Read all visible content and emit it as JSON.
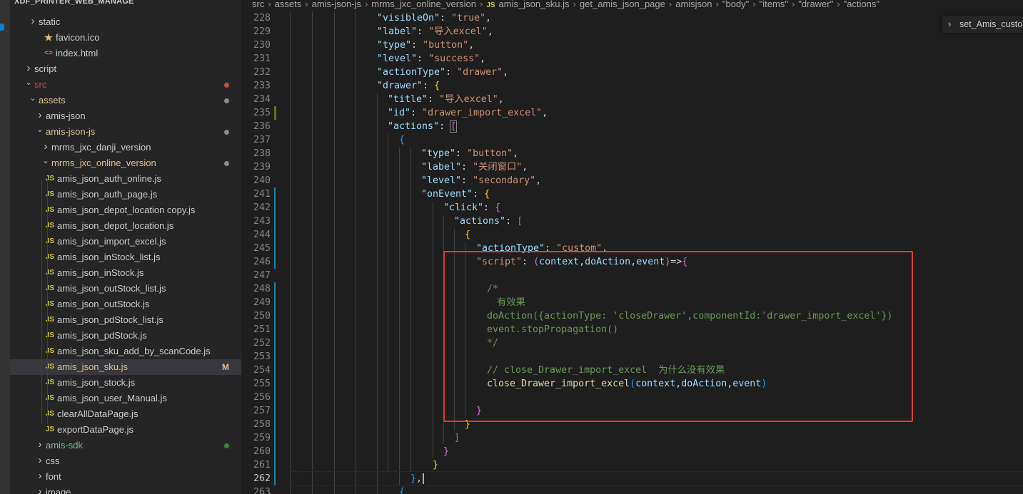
{
  "explorer": {
    "root": "XDF_PRINTER_WEB_MANAGE",
    "items": [
      {
        "label": "static",
        "type": "folder-closed",
        "depth": 1,
        "icon": "chevron-right"
      },
      {
        "label": "favicon.ico",
        "type": "file",
        "depth": 1,
        "icon": "star-icon"
      },
      {
        "label": "index.html",
        "type": "file",
        "depth": 1,
        "icon": "html-icon"
      },
      {
        "label": "script",
        "type": "folder-closed",
        "depth": 0,
        "icon": "chevron-right"
      },
      {
        "label": "src",
        "type": "folder-open",
        "depth": 0,
        "icon": "chevron-down",
        "status": "error-dot"
      },
      {
        "label": "assets",
        "type": "folder-open",
        "depth": 1,
        "icon": "chevron-down",
        "status": "modified-dot"
      },
      {
        "label": "amis-json",
        "type": "folder-closed",
        "depth": 2,
        "icon": "chevron-right"
      },
      {
        "label": "amis-json-js",
        "type": "folder-open",
        "depth": 2,
        "icon": "chevron-down",
        "status": "modified-dot"
      },
      {
        "label": "mrms_jxc_danji_version",
        "type": "folder-closed",
        "depth": 3,
        "icon": "chevron-right"
      },
      {
        "label": "mrms_jxc_online_version",
        "type": "folder-open",
        "depth": 3,
        "icon": "chevron-down",
        "status": "modified-dot"
      },
      {
        "label": "amis_json_auth_online.js",
        "type": "js",
        "depth": 4
      },
      {
        "label": "amis_json_auth_page.js",
        "type": "js",
        "depth": 4
      },
      {
        "label": "amis_json_depot_location copy.js",
        "type": "js",
        "depth": 4
      },
      {
        "label": "amis_json_depot_location.js",
        "type": "js",
        "depth": 4
      },
      {
        "label": "amis_json_import_excel.js",
        "type": "js",
        "depth": 4
      },
      {
        "label": "amis_json_inStock_list.js",
        "type": "js",
        "depth": 4
      },
      {
        "label": "amis_json_inStock.js",
        "type": "js",
        "depth": 4
      },
      {
        "label": "amis_json_outStock_list.js",
        "type": "js",
        "depth": 4
      },
      {
        "label": "amis_json_outStock.js",
        "type": "js",
        "depth": 4
      },
      {
        "label": "amis_json_pdStock_list.js",
        "type": "js",
        "depth": 4
      },
      {
        "label": "amis_json_pdStock.js",
        "type": "js",
        "depth": 4
      },
      {
        "label": "amis_json_sku_add_by_scanCode.js",
        "type": "js",
        "depth": 4
      },
      {
        "label": "amis_json_sku.js",
        "type": "js",
        "depth": 4,
        "selected": true,
        "badge": "M"
      },
      {
        "label": "amis_json_stock.js",
        "type": "js",
        "depth": 4
      },
      {
        "label": "amis_json_user_Manual.js",
        "type": "js",
        "depth": 4
      },
      {
        "label": "clearAllDataPage.js",
        "type": "js",
        "depth": 4
      },
      {
        "label": "exportDataPage.js",
        "type": "js",
        "depth": 4
      },
      {
        "label": "amis-sdk",
        "type": "folder-closed",
        "depth": 2,
        "icon": "chevron-right",
        "status": "green-dot",
        "green": true
      },
      {
        "label": "css",
        "type": "folder-closed",
        "depth": 2,
        "icon": "chevron-right"
      },
      {
        "label": "font",
        "type": "folder-closed",
        "depth": 2,
        "icon": "chevron-right"
      },
      {
        "label": "image",
        "type": "folder-closed",
        "depth": 2,
        "icon": "chevron-right"
      }
    ],
    "js_badge": "JS"
  },
  "breadcrumb": [
    "src",
    "assets",
    "amis-json-js",
    "mrms_jxc_online_version",
    "JS",
    "amis_json_sku.js",
    "get_amis_json_page",
    "amisjson",
    "\"body\"",
    "\"items\"",
    "\"drawer\"",
    "\"actions\""
  ],
  "sticky_scroll": {
    "label": "set_Amis_custo"
  },
  "colors": {
    "error": "#c74e39",
    "modified": "#8c8c8c",
    "added": "#388a34",
    "highlight_box": "#e03a3a",
    "js_icon": "#cbcb41"
  },
  "code_lines": [
    {
      "n": "228",
      "t": "\"visibleOn\": \"true\","
    },
    {
      "n": "229",
      "t": "\"label\": \"导入excel\","
    },
    {
      "n": "230",
      "t": "\"type\": \"button\","
    },
    {
      "n": "231",
      "t": "\"level\": \"success\","
    },
    {
      "n": "232",
      "t": "\"actionType\": \"drawer\","
    },
    {
      "n": "233",
      "t": "\"drawer\": {"
    },
    {
      "n": "234",
      "t": "\"title\": \"导入excel\","
    },
    {
      "n": "235",
      "t": "\"id\": \"drawer_import_excel\","
    },
    {
      "n": "236",
      "t": "\"actions\": ["
    },
    {
      "n": "237",
      "t": "{"
    },
    {
      "n": "238",
      "t": "\"type\": \"button\","
    },
    {
      "n": "239",
      "t": "\"label\": \"关闭窗口\","
    },
    {
      "n": "240",
      "t": "\"level\": \"secondary\","
    },
    {
      "n": "241",
      "t": "\"onEvent\": {"
    },
    {
      "n": "242",
      "t": "\"click\": {"
    },
    {
      "n": "243",
      "t": "\"actions\": ["
    },
    {
      "n": "244",
      "t": "{"
    },
    {
      "n": "245",
      "t": "\"actionType\": \"custom\","
    },
    {
      "n": "246",
      "t": "\"script\": (context,doAction,event)=>{"
    },
    {
      "n": "247",
      "t": ""
    },
    {
      "n": "248",
      "t": "/*"
    },
    {
      "n": "249",
      "t": "有效果"
    },
    {
      "n": "250",
      "t": "doAction({actionType: 'closeDrawer',componentId:'drawer_import_excel'})"
    },
    {
      "n": "251",
      "t": "event.stopPropagation()"
    },
    {
      "n": "252",
      "t": "*/"
    },
    {
      "n": "253",
      "t": ""
    },
    {
      "n": "254",
      "t": "// close_Drawer_import_excel  为什么没有效果"
    },
    {
      "n": "255",
      "t": "close_Drawer_import_excel(context,doAction,event)"
    },
    {
      "n": "256",
      "t": ""
    },
    {
      "n": "257",
      "t": "}"
    },
    {
      "n": "258",
      "t": "}"
    },
    {
      "n": "259",
      "t": "]"
    },
    {
      "n": "260",
      "t": "}"
    },
    {
      "n": "261",
      "t": "}"
    },
    {
      "n": "262",
      "t": "},"
    },
    {
      "n": "263",
      "t": "{"
    }
  ]
}
